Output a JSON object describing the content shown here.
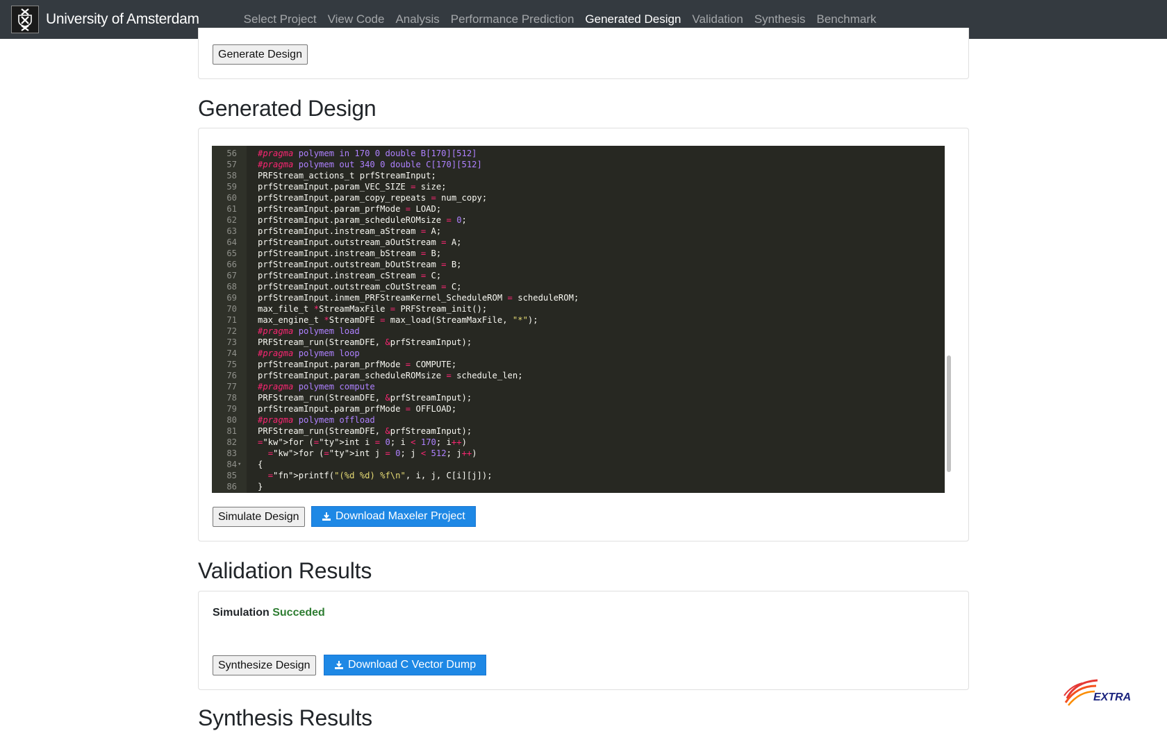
{
  "navbar": {
    "brand": "University of Amsterdam",
    "links": [
      {
        "label": "Select Project",
        "active": false
      },
      {
        "label": "View Code",
        "active": false
      },
      {
        "label": "Analysis",
        "active": false
      },
      {
        "label": "Performance Prediction",
        "active": false
      },
      {
        "label": "Generated Design",
        "active": true
      },
      {
        "label": "Validation",
        "active": false
      },
      {
        "label": "Synthesis",
        "active": false
      },
      {
        "label": "Benchmark",
        "active": false
      }
    ]
  },
  "top_section": {
    "generate_button": "Generate Design"
  },
  "generated_design": {
    "heading": "Generated Design",
    "code_lines": [
      {
        "n": "56",
        "text": "#pragma polymem in 170 0 double B[170][512]"
      },
      {
        "n": "57",
        "text": "#pragma polymem out 340 0 double C[170][512]"
      },
      {
        "n": "58",
        "text": "PRFStream_actions_t prfStreamInput;"
      },
      {
        "n": "59",
        "text": "prfStreamInput.param_VEC_SIZE = size;"
      },
      {
        "n": "60",
        "text": "prfStreamInput.param_copy_repeats = num_copy;"
      },
      {
        "n": "61",
        "text": "prfStreamInput.param_prfMode = LOAD;"
      },
      {
        "n": "62",
        "text": "prfStreamInput.param_scheduleROMsize = 0;"
      },
      {
        "n": "63",
        "text": "prfStreamInput.instream_aStream = A;"
      },
      {
        "n": "64",
        "text": "prfStreamInput.outstream_aOutStream = A;"
      },
      {
        "n": "65",
        "text": "prfStreamInput.instream_bStream = B;"
      },
      {
        "n": "66",
        "text": "prfStreamInput.outstream_bOutStream = B;"
      },
      {
        "n": "67",
        "text": "prfStreamInput.instream_cStream = C;"
      },
      {
        "n": "68",
        "text": "prfStreamInput.outstream_cOutStream = C;"
      },
      {
        "n": "69",
        "text": "prfStreamInput.inmem_PRFStreamKernel_ScheduleROM = scheduleROM;"
      },
      {
        "n": "70",
        "text": "max_file_t *StreamMaxFile = PRFStream_init();"
      },
      {
        "n": "71",
        "text": "max_engine_t *StreamDFE = max_load(StreamMaxFile, \"*\");"
      },
      {
        "n": "72",
        "text": "#pragma polymem load"
      },
      {
        "n": "73",
        "text": "PRFStream_run(StreamDFE, &prfStreamInput);"
      },
      {
        "n": "74",
        "text": "#pragma polymem loop"
      },
      {
        "n": "75",
        "text": "prfStreamInput.param_prfMode = COMPUTE;"
      },
      {
        "n": "76",
        "text": "prfStreamInput.param_scheduleROMsize = schedule_len;"
      },
      {
        "n": "77",
        "text": "#pragma polymem compute"
      },
      {
        "n": "78",
        "text": "PRFStream_run(StreamDFE, &prfStreamInput);"
      },
      {
        "n": "79",
        "text": "prfStreamInput.param_prfMode = OFFLOAD;"
      },
      {
        "n": "80",
        "text": "#pragma polymem offload"
      },
      {
        "n": "81",
        "text": "PRFStream_run(StreamDFE, &prfStreamInput);"
      },
      {
        "n": "82",
        "text": "for (int i = 0; i < 170; i++)"
      },
      {
        "n": "83",
        "text": "  for (int j = 0; j < 512; j++)"
      },
      {
        "n": "84",
        "text": "{"
      },
      {
        "n": "85",
        "text": "  printf(\"(%d %d) %f\\n\", i, j, C[i][j]);"
      },
      {
        "n": "86",
        "text": "}"
      }
    ],
    "simulate_button": "Simulate Design",
    "download_button": "Download Maxeler Project"
  },
  "validation": {
    "heading": "Validation Results",
    "status_label": "Simulation",
    "status_value": "Succeded",
    "synthesize_button": "Synthesize Design",
    "download_button": "Download C Vector Dump"
  },
  "synthesis": {
    "heading": "Synthesis Results"
  },
  "footer_logo_text": "EXTRA",
  "colors": {
    "navbar_bg": "#343a40",
    "primary": "#1e88e5",
    "success": "#2e7d32",
    "editor_bg": "#272822"
  }
}
